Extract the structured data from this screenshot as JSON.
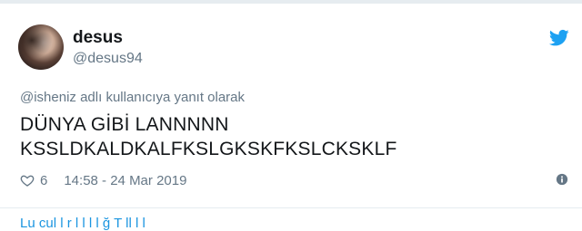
{
  "tweet": {
    "display_name": "desus",
    "handle": "@desus94",
    "reply_context": "@isheniz adlı kullanıcıya yanıt olarak",
    "text_line1": "DÜNYA GİBİ LANNNNN",
    "text_line2": "KSSLDKALDKALFKSLGKSKFKSLCKSKLF",
    "likes": "6",
    "timestamp": "14:58 - 24 Mar 2019"
  },
  "footer": {
    "fragment": "Lu    cul l r l  l  l l ğ    T    ll   l  l  "
  },
  "icons": {
    "brand": "twitter-bird-icon",
    "like": "heart-icon",
    "info": "info-icon"
  },
  "colors": {
    "brand_blue": "#1da1f2",
    "text_primary": "#14171a",
    "text_secondary": "#657786"
  }
}
